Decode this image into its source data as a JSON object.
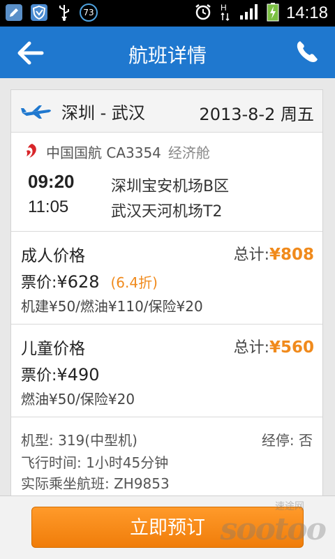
{
  "status_bar": {
    "notification_count": "73",
    "time": "14:18"
  },
  "header": {
    "title": "航班详情"
  },
  "route": {
    "cities": "深圳 - 武汉",
    "date": "2013-8-2 周五"
  },
  "flight": {
    "airline": "中国国航 CA3354",
    "cabin": "经济舱",
    "departure_time": "09:20",
    "arrival_time": "11:05",
    "departure_airport": "深圳宝安机场B区",
    "arrival_airport": "武汉天河机场T2"
  },
  "adult_price": {
    "title": "成人价格",
    "total_label": "总计:",
    "total_amount": "¥808",
    "fare_label": "票价:",
    "fare": "¥628",
    "discount": "(6.4折)",
    "fees": "机建¥50/燃油¥110/保险¥20"
  },
  "child_price": {
    "title": "儿童价格",
    "total_label": "总计:",
    "total_amount": "¥560",
    "fare_label": "票价:",
    "fare": "¥490",
    "fees": "燃油¥50/保险¥20"
  },
  "info": {
    "aircraft": "机型: 319(中型机)",
    "stop": "经停: 否",
    "duration": "飞行时间: 1小时45分钟",
    "operating_flight": "实际乘坐航班: ZH9853"
  },
  "footer": {
    "book_label": "立即预订",
    "watermark": "sootoo",
    "watermark_cn": "速途网"
  },
  "colors": {
    "header_blue": "#1f78cf",
    "accent_orange": "#f08a1c"
  }
}
